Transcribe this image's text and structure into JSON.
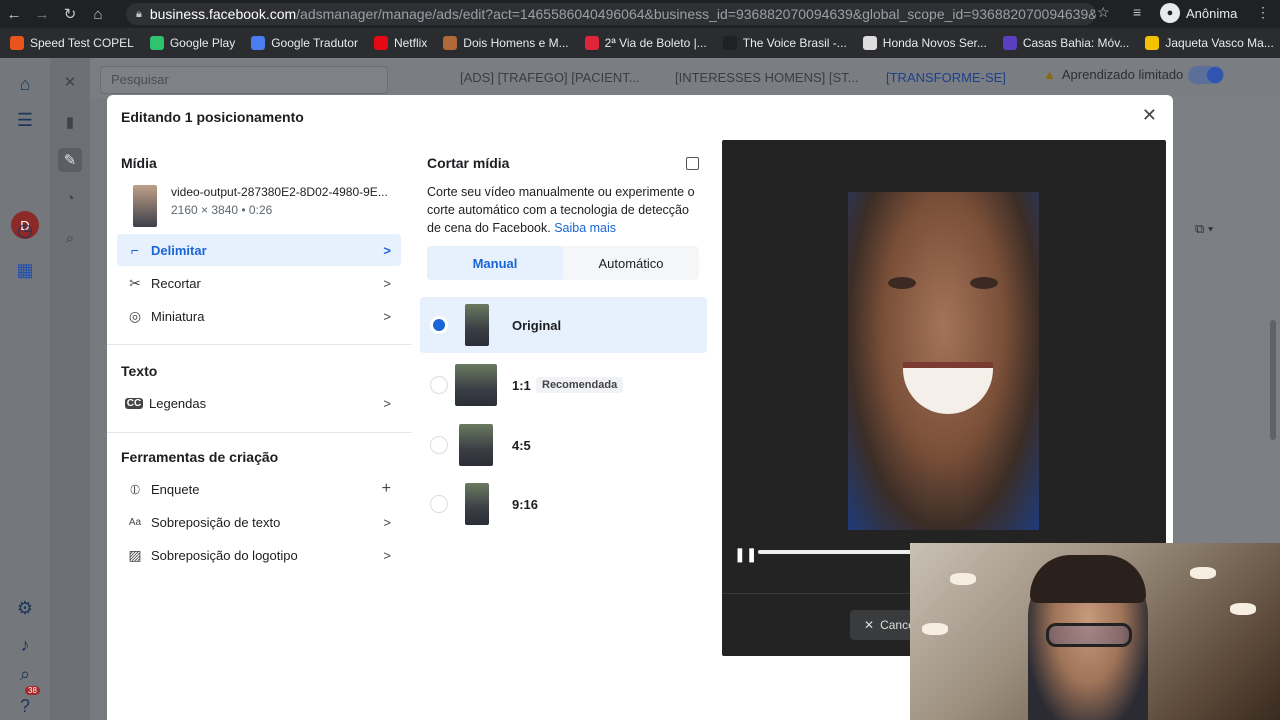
{
  "browser": {
    "url_host": "business.facebook.com",
    "url_path": "/adsmanager/manage/ads/edit?act=1465586040496064&business_id=936882070094639&global_scope_id=936882070094639&n...",
    "profile_name": "Anônima",
    "bookmarks": [
      {
        "label": "Speed Test COPEL",
        "color": "#e8541c"
      },
      {
        "label": "Google Play",
        "color": "#2ec46d"
      },
      {
        "label": "Google Tradutor",
        "color": "#4a7ef0"
      },
      {
        "label": "Netflix",
        "color": "#e50914"
      },
      {
        "label": "Dois Homens e M...",
        "color": "#b06a3a"
      },
      {
        "label": "2ª Via de Boleto |...",
        "color": "#e0243a"
      },
      {
        "label": "The Voice Brasil -...",
        "color": "#202124"
      },
      {
        "label": "Honda Novos Ser...",
        "color": "#dddddd"
      },
      {
        "label": "Casas Bahia: Móv...",
        "color": "#5a3fc0"
      },
      {
        "label": "Jaqueta Vasco Ma...",
        "color": "#f2c200"
      }
    ]
  },
  "left_nav": {
    "avatar_letter": "D",
    "notification_count": "38"
  },
  "background": {
    "search_placeholder": "Pesquisar",
    "crumbs": [
      "[ADS] [TRAFEGO] [PACIENT...",
      "[INTERESSES HOMENS] [ST...",
      "[TRANSFORME-SE]"
    ],
    "learning_label": "Aprendizado limitado"
  },
  "modal": {
    "title": "Editando 1 posicionamento",
    "media_section": "Mídia",
    "file_name": "video-output-287380E2-8D02-4980-9E...",
    "file_meta": "2160 × 3840 • 0:26",
    "media_items": [
      {
        "label": "Delimitar",
        "icon": "crop-icon"
      },
      {
        "label": "Recortar",
        "icon": "scissors-icon"
      },
      {
        "label": "Miniatura",
        "icon": "thumbnail-icon"
      }
    ],
    "text_section": "Texto",
    "text_items": [
      {
        "label": "Legendas",
        "icon": "cc-icon"
      }
    ],
    "tools_section": "Ferramentas de criação",
    "tool_items": [
      {
        "label": "Enquete",
        "icon": "poll-icon"
      },
      {
        "label": "Sobreposição de texto",
        "icon": "text-overlay-icon"
      },
      {
        "label": "Sobreposição do logotipo",
        "icon": "image-icon"
      }
    ],
    "crop_title": "Cortar mídia",
    "crop_desc": "Corte seu vídeo manualmente ou experimente o corte automático com a tecnologia de detecção de cena do Facebook.",
    "crop_link": "Saiba mais",
    "tabs": [
      "Manual",
      "Automático"
    ],
    "options": [
      {
        "label": "Original",
        "selected": true
      },
      {
        "label": "1:1",
        "badge": "Recomendada"
      },
      {
        "label": "4:5"
      },
      {
        "label": "9:16"
      }
    ],
    "cancel_label": "Cancelar"
  }
}
